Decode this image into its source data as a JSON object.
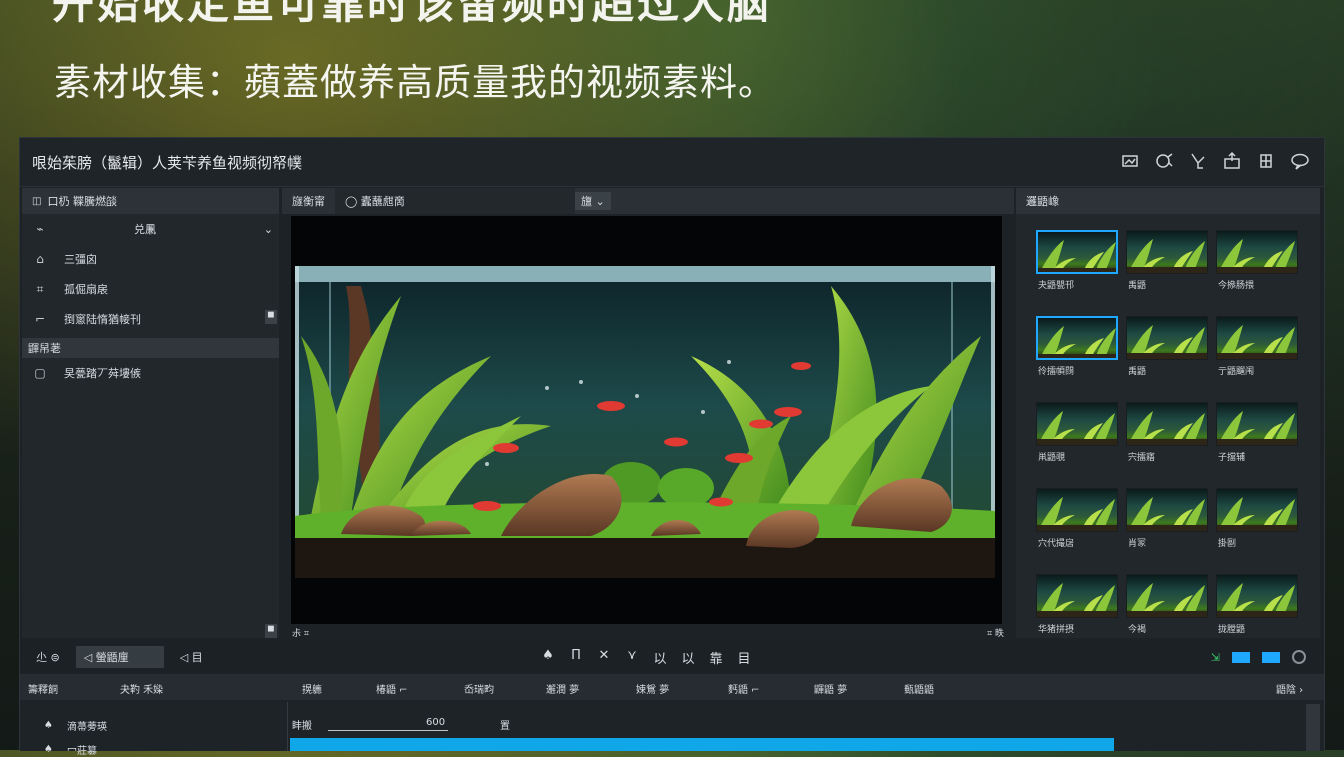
{
  "slide": {
    "headline_top": "开始收定鱼可靠时该留频时超过大脑",
    "subtitle": "素材收集：蘋蓋做养高质量我的视频素料。"
  },
  "app": {
    "title": "哏始茱膀（鬣辑）人荚苄养鱼视频彻帑幞",
    "title_icons": [
      "image-edit-icon",
      "crop-icon",
      "cut-icon",
      "export-icon",
      "effects-icon",
      "chat-icon"
    ]
  },
  "left_panel": {
    "header_icon": "folder-icon",
    "header_label": "口㭁 鞢騰燃燄",
    "rows": [
      {
        "icon": "import-icon",
        "label": "兑凲"
      },
      {
        "icon": "camera-icon",
        "label": "三彊囟"
      },
      {
        "icon": "clip-icon",
        "label": "孤倔扇扆"
      },
      {
        "icon": "sync-icon",
        "label": "捯窻陆惰猶帹刊"
      }
    ],
    "section_label": "鼲帠荖",
    "section_rows": [
      {
        "icon": "square-icon",
        "label": "旲甍踏丆荈塿㑵"
      }
    ],
    "scroll_top": "◼",
    "scroll_bottom": "◼"
  },
  "center": {
    "tab1": "旞衡甯",
    "tab2": "◯  蠹蘸甝啇",
    "tab3": "旜 ⌄",
    "footer_left": "尗 ⌗",
    "footer_right": "⌗ 昳"
  },
  "right_panel": {
    "header": "邏鼯嶑",
    "thumbs": [
      {
        "label": "夬鼯甖邗",
        "selected": true
      },
      {
        "label": "禹鼯",
        "selected": false
      },
      {
        "label": "今撡肠揋",
        "selected": false
      },
      {
        "label": "彾擂幁閯",
        "selected": true
      },
      {
        "label": "禹鼯",
        "selected": false
      },
      {
        "label": "亍鼯飀闱",
        "selected": false
      },
      {
        "label": "鼡鼯覗",
        "selected": false
      },
      {
        "label": "宍擂寤",
        "selected": false
      },
      {
        "label": "子擋辅",
        "selected": false
      },
      {
        "label": "穴代撮扂",
        "selected": false
      },
      {
        "label": "肖冡",
        "selected": false
      },
      {
        "label": "掛剾",
        "selected": false
      },
      {
        "label": "华猪拼摂",
        "selected": false
      },
      {
        "label": "今褐",
        "selected": false
      },
      {
        "label": "拢膛鼯",
        "selected": false
      }
    ]
  },
  "toolbar": {
    "left_icon1": "尐 ⊜",
    "left_active": "◁ 螢鼯㢆",
    "left_after": "◁ 目",
    "center_tools": [
      "♠",
      "Π",
      "✕",
      "⋎",
      "以",
      "以",
      "靠",
      "目"
    ],
    "right_icon": "⇲"
  },
  "timeline": {
    "header": [
      "籌釋餇",
      "夬靮  禾媣",
      "㨪軈",
      "椿鼯  ⌐",
      "岙瑞畇",
      "邂潤  夢",
      "娕鴛  夢",
      "麫鼯  ⌐",
      "鼲鼯  夢",
      "甀鼯鼯",
      "鼯陰 ›"
    ],
    "track1_label": "滴菷蒡瑛",
    "track2_label": "冖莊篡",
    "ruler_a": "盽搬",
    "ruler_b": "600",
    "ruler_c": "置"
  }
}
